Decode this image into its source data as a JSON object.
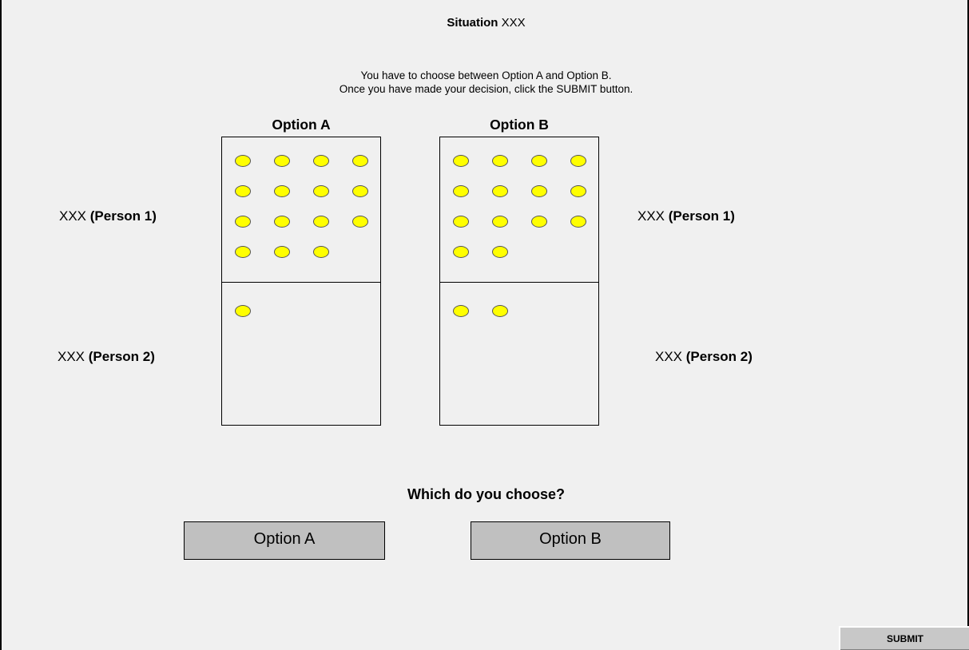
{
  "header": {
    "situation_label": "Situation",
    "situation_value": "XXX",
    "instruction_line1": "You have to choose between Option A and Option B.",
    "instruction_line2": "Once you have made your decision, click the SUBMIT button."
  },
  "options": [
    {
      "title": "Option A",
      "person1_coins": 15,
      "person2_coins": 1
    },
    {
      "title": "Option B",
      "person1_coins": 14,
      "person2_coins": 2
    }
  ],
  "labels": {
    "left_person1_prefix": "XXX",
    "left_person1_name": "(Person 1)",
    "left_person2_prefix": "XXX",
    "left_person2_name": "(Person 2)",
    "right_person1_prefix": "XXX",
    "right_person1_name": "(Person 1)",
    "right_person2_prefix": "XXX",
    "right_person2_name": "(Person 2)"
  },
  "question": "Which do you choose?",
  "choice_buttons": {
    "a_label": "Option A",
    "b_label": "Option B"
  },
  "submit_label": "SUBMIT",
  "colors": {
    "coin": "#ffff00",
    "choice_button": "#c0c0c0",
    "background": "#f0f0f0"
  }
}
